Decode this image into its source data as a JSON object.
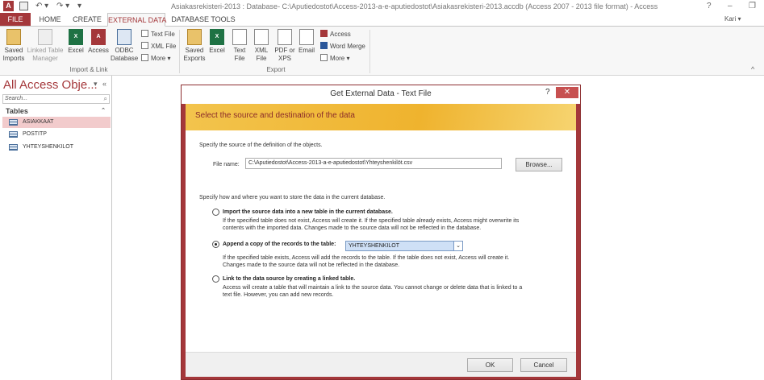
{
  "titlebar": {
    "app_icon": "A",
    "save_icon": "save-icon",
    "undo_glyph": "↶ ▾",
    "redo_glyph": "↷ ▾",
    "qat_more": "▾",
    "title": "Asiakasrekisteri-2013 : Database- C:\\Aputiedostot\\Access-2013-a-e-aputiedostot\\Asiakasrekisteri-2013.accdb (Access 2007 - 2013 file format) - Access",
    "help": "?",
    "minimize": "–",
    "restore": "❐"
  },
  "tabs": [
    "FILE",
    "HOME",
    "CREATE",
    "EXTERNAL DATA",
    "DATABASE TOOLS"
  ],
  "active_tab": "EXTERNAL DATA",
  "user": "Kari ▾",
  "ribbon": {
    "import_group": {
      "label": "Import & Link",
      "saved_imports": "Saved Imports",
      "linked_table_manager": "Linked Table Manager",
      "excel": "Excel",
      "access": "Access",
      "odbc": "ODBC Database",
      "text_file": "Text File",
      "xml_file": "XML File",
      "more": "More ▾"
    },
    "export_group": {
      "label": "Export",
      "saved_exports": "Saved Exports",
      "excel": "Excel",
      "text_file": "Text File",
      "xml_file": "XML File",
      "pdf": "PDF or XPS",
      "email": "Email",
      "access": "Access",
      "word_merge": "Word Merge",
      "more": "More ▾"
    },
    "collapse": "^"
  },
  "nav": {
    "title": "All Access Obje...",
    "menu_glyph": "▾",
    "shutter": "«",
    "search_placeholder": "Search...",
    "search_glyph": "⌕",
    "group": "Tables",
    "group_chevron": "⌃",
    "items": [
      "ASIAKKAAT",
      "POSTITP",
      "YHTEYSHENKILOT"
    ]
  },
  "dialog": {
    "title": "Get External Data - Text File",
    "help": "?",
    "close": "✕",
    "banner": "Select the source and destination of the data",
    "source_prompt": "Specify the source of the definition of the objects.",
    "file_label": "File name:",
    "file_value": "C:\\Aputiedostot\\Access-2013-a-e-aputiedostot\\Yhteyshenkilöt.csv",
    "browse": "Browse...",
    "store_prompt": "Specify how and where you want to store the data in the current database.",
    "options": [
      {
        "label": "Import the source data into a new table in the current database.",
        "desc": "If the specified table does not exist, Access will create it. If the specified table already exists, Access might overwrite its\ncontents with the imported data. Changes made to the source data will not be reflected in the database.",
        "selected": false
      },
      {
        "label": "Append a copy of the records to the table:",
        "desc": "If the specified table exists, Access will add the records to the table. If the table does not exist, Access will create it.\nChanges made to the source data will not be reflected in the database.",
        "selected": true
      },
      {
        "label": "Link to the data source by creating a linked table.",
        "desc": "Access will create a table that will maintain a link to the source data. You cannot change or delete data that is linked to a\ntext file. However, you can add new records.",
        "selected": false
      }
    ],
    "append_table": "YHTEYSHENKILOT",
    "dropdown_glyph": "⌄",
    "ok": "OK",
    "cancel": "Cancel"
  }
}
